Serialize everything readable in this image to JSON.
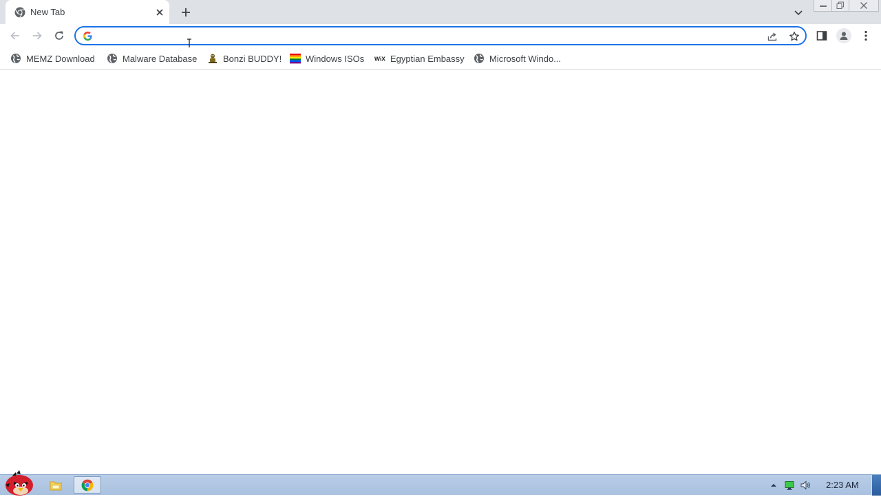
{
  "tab": {
    "title": "New Tab",
    "favicon": "chrome-icon"
  },
  "omnibox": {
    "value": "",
    "placeholder": "",
    "icon": "google-g-icon"
  },
  "bookmarks": [
    {
      "label": "MEMZ Download",
      "icon": "globe-icon"
    },
    {
      "label": "Malware Database",
      "icon": "globe-icon"
    },
    {
      "label": "Bonzi BUDDY!",
      "icon": "bonzi-icon"
    },
    {
      "label": "Windows ISOs",
      "icon": "rainbow-flag-icon"
    },
    {
      "label": "Egyptian Embassy",
      "icon": "wix-icon"
    },
    {
      "label": "Microsoft Windo...",
      "icon": "globe-icon"
    }
  ],
  "taskbar": {
    "clock": "2:23 AM",
    "apps": [
      "explorer-icon",
      "chrome-icon"
    ],
    "start_icon": "angry-bird-icon"
  },
  "colors": {
    "accent": "#1a73e8",
    "tabstrip": "#dee1e6",
    "taskbar": "#b0c6e2"
  }
}
